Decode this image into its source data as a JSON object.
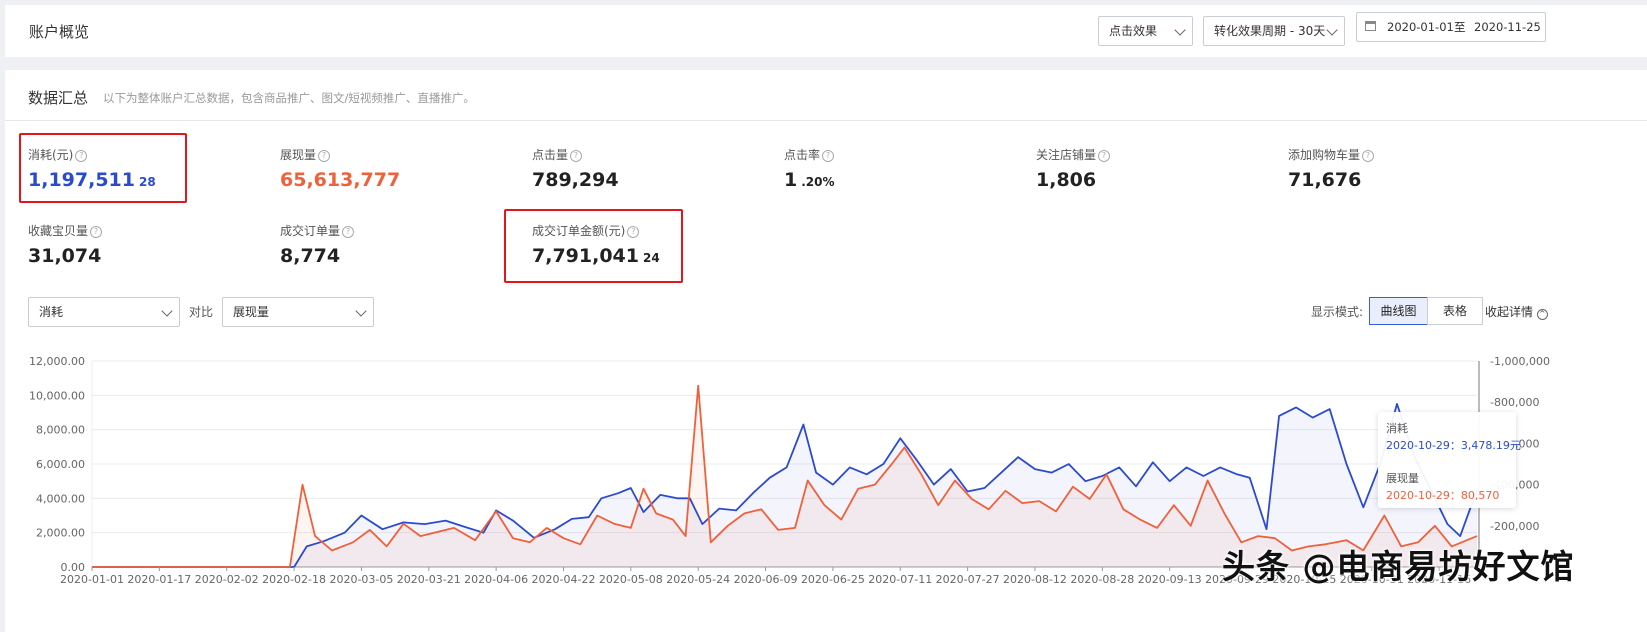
{
  "header": {
    "title": "账户概览",
    "effect_select": "点击效果",
    "period_select": "转化效果周期 - 30天",
    "date_from": "2020-01-01",
    "date_sep": "至",
    "date_to": "2020-11-25"
  },
  "summary": {
    "title": "数据汇总",
    "desc": "以下为整体账户汇总数据，包含商品推广、图文/短视频推广、直播推广。",
    "help_glyph": "?",
    "metrics": [
      {
        "label": "消耗(元)",
        "int": "1,197,511",
        "dec": "28",
        "color": "#2b4bcf"
      },
      {
        "label": "展现量",
        "int": "65,613,777",
        "dec": "",
        "color": "#f0603a"
      },
      {
        "label": "点击量",
        "int": "789,294",
        "dec": "",
        "color": "#222222"
      },
      {
        "label": "点击率",
        "int": "1",
        "dec": ".20%",
        "color": "#222222"
      },
      {
        "label": "关注店铺量",
        "int": "1,806",
        "dec": "",
        "color": "#222222"
      },
      {
        "label": "添加购物车量",
        "int": "71,676",
        "dec": "",
        "color": "#222222"
      },
      {
        "label": "收藏宝贝量",
        "int": "31,074",
        "dec": "",
        "color": "#222222"
      },
      {
        "label": "成交订单量",
        "int": "8,774",
        "dec": "",
        "color": "#222222"
      },
      {
        "label": "成交订单金额(元)",
        "int": "7,791,041",
        "dec": "24",
        "color": "#222222"
      }
    ]
  },
  "chart_controls": {
    "primary_select": "消耗",
    "compare_label": "对比",
    "secondary_select": "展现量",
    "mode_label": "显示模式:",
    "mode_curve": "曲线图",
    "mode_table": "表格",
    "collapse": "收起详情"
  },
  "tooltip": {
    "s1_name": "消耗",
    "s1_line": "2020-10-29：3,478.19元",
    "s2_name": "展现量",
    "s2_line": "2020-10-29：80,570"
  },
  "watermark": "头条 @电商易坊好文馆",
  "colors": {
    "blue": "#2b4bcf",
    "orange": "#f0603a",
    "highlight": "#e3161b"
  },
  "chart_data": {
    "type": "line",
    "x_ticks": [
      "2020-01-01",
      "2020-01-17",
      "2020-02-02",
      "2020-02-18",
      "2020-03-05",
      "2020-03-21",
      "2020-04-06",
      "2020-04-22",
      "2020-05-08",
      "2020-05-24",
      "2020-06-09",
      "2020-06-25",
      "2020-07-11",
      "2020-07-27",
      "2020-08-12",
      "2020-08-28",
      "2020-09-13",
      "2020-09-29",
      "2020-10-15",
      "2020-10-31",
      "2020-11-16"
    ],
    "y_left_ticks": [
      "0.00",
      "2,000.00",
      "4,000.00",
      "6,000.00",
      "8,000.00",
      "10,000.00",
      "12,000.00"
    ],
    "y_right_ticks": [
      "200,000",
      "400,000",
      "600,000",
      "800,000",
      "1,000,000"
    ],
    "ylim_left": [
      0,
      12000
    ],
    "ylim_right": [
      0,
      1000000
    ],
    "series": [
      {
        "name": "消耗",
        "axis": "left",
        "color": "#2b4bcf",
        "points": [
          [
            "2020-01-01",
            0
          ],
          [
            "2020-02-18",
            0
          ],
          [
            "2020-02-21",
            1200
          ],
          [
            "2020-02-25",
            1500
          ],
          [
            "2020-03-01",
            2000
          ],
          [
            "2020-03-05",
            3000
          ],
          [
            "2020-03-10",
            2200
          ],
          [
            "2020-03-15",
            2600
          ],
          [
            "2020-03-20",
            2500
          ],
          [
            "2020-03-25",
            2700
          ],
          [
            "2020-03-30",
            2300
          ],
          [
            "2020-04-03",
            2000
          ],
          [
            "2020-04-06",
            3300
          ],
          [
            "2020-04-10",
            2700
          ],
          [
            "2020-04-15",
            1700
          ],
          [
            "2020-04-20",
            2200
          ],
          [
            "2020-04-24",
            2800
          ],
          [
            "2020-04-28",
            2900
          ],
          [
            "2020-05-01",
            4000
          ],
          [
            "2020-05-05",
            4300
          ],
          [
            "2020-05-08",
            4600
          ],
          [
            "2020-05-11",
            3200
          ],
          [
            "2020-05-15",
            4200
          ],
          [
            "2020-05-19",
            4000
          ],
          [
            "2020-05-22",
            4000
          ],
          [
            "2020-05-25",
            2500
          ],
          [
            "2020-05-29",
            3400
          ],
          [
            "2020-06-02",
            3300
          ],
          [
            "2020-06-06",
            4300
          ],
          [
            "2020-06-10",
            5200
          ],
          [
            "2020-06-14",
            5800
          ],
          [
            "2020-06-18",
            8300
          ],
          [
            "2020-06-21",
            5500
          ],
          [
            "2020-06-25",
            4800
          ],
          [
            "2020-06-29",
            5800
          ],
          [
            "2020-07-03",
            5400
          ],
          [
            "2020-07-07",
            6000
          ],
          [
            "2020-07-11",
            7500
          ],
          [
            "2020-07-15",
            6200
          ],
          [
            "2020-07-19",
            4800
          ],
          [
            "2020-07-23",
            5700
          ],
          [
            "2020-07-27",
            4400
          ],
          [
            "2020-07-31",
            4600
          ],
          [
            "2020-08-04",
            5500
          ],
          [
            "2020-08-08",
            6400
          ],
          [
            "2020-08-12",
            5700
          ],
          [
            "2020-08-16",
            5500
          ],
          [
            "2020-08-20",
            6000
          ],
          [
            "2020-08-24",
            5000
          ],
          [
            "2020-08-28",
            5300
          ],
          [
            "2020-09-01",
            5800
          ],
          [
            "2020-09-05",
            4700
          ],
          [
            "2020-09-09",
            6100
          ],
          [
            "2020-09-13",
            5000
          ],
          [
            "2020-09-17",
            5800
          ],
          [
            "2020-09-21",
            5300
          ],
          [
            "2020-09-25",
            5800
          ],
          [
            "2020-09-29",
            5400
          ],
          [
            "2020-10-02",
            5200
          ],
          [
            "2020-10-06",
            2200
          ],
          [
            "2020-10-09",
            8800
          ],
          [
            "2020-10-13",
            9300
          ],
          [
            "2020-10-17",
            8700
          ],
          [
            "2020-10-21",
            9200
          ],
          [
            "2020-10-25",
            6000
          ],
          [
            "2020-10-29",
            3478
          ],
          [
            "2020-11-02",
            6000
          ],
          [
            "2020-11-06",
            9500
          ],
          [
            "2020-11-10",
            6500
          ],
          [
            "2020-11-14",
            4500
          ],
          [
            "2020-11-18",
            2500
          ],
          [
            "2020-11-21",
            1800
          ],
          [
            "2020-11-25",
            4500
          ]
        ]
      },
      {
        "name": "展现量",
        "axis": "right",
        "color": "#f0603a",
        "points": [
          [
            "2020-01-01",
            0
          ],
          [
            "2020-02-17",
            0
          ],
          [
            "2020-02-20",
            400000
          ],
          [
            "2020-02-23",
            150000
          ],
          [
            "2020-02-27",
            80000
          ],
          [
            "2020-03-03",
            120000
          ],
          [
            "2020-03-07",
            180000
          ],
          [
            "2020-03-11",
            100000
          ],
          [
            "2020-03-15",
            210000
          ],
          [
            "2020-03-19",
            150000
          ],
          [
            "2020-03-23",
            170000
          ],
          [
            "2020-03-27",
            190000
          ],
          [
            "2020-04-01",
            130000
          ],
          [
            "2020-04-06",
            270000
          ],
          [
            "2020-04-10",
            140000
          ],
          [
            "2020-04-14",
            120000
          ],
          [
            "2020-04-18",
            190000
          ],
          [
            "2020-04-22",
            140000
          ],
          [
            "2020-04-26",
            110000
          ],
          [
            "2020-04-30",
            250000
          ],
          [
            "2020-05-04",
            210000
          ],
          [
            "2020-05-08",
            190000
          ],
          [
            "2020-05-11",
            380000
          ],
          [
            "2020-05-14",
            260000
          ],
          [
            "2020-05-18",
            230000
          ],
          [
            "2020-05-21",
            150000
          ],
          [
            "2020-05-24",
            880000
          ],
          [
            "2020-05-27",
            120000
          ],
          [
            "2020-05-31",
            200000
          ],
          [
            "2020-06-04",
            260000
          ],
          [
            "2020-06-08",
            280000
          ],
          [
            "2020-06-12",
            180000
          ],
          [
            "2020-06-16",
            190000
          ],
          [
            "2020-06-19",
            420000
          ],
          [
            "2020-06-23",
            300000
          ],
          [
            "2020-06-27",
            230000
          ],
          [
            "2020-07-01",
            380000
          ],
          [
            "2020-07-05",
            400000
          ],
          [
            "2020-07-09",
            500000
          ],
          [
            "2020-07-12",
            580000
          ],
          [
            "2020-07-16",
            450000
          ],
          [
            "2020-07-20",
            300000
          ],
          [
            "2020-07-24",
            420000
          ],
          [
            "2020-07-28",
            330000
          ],
          [
            "2020-08-01",
            280000
          ],
          [
            "2020-08-05",
            370000
          ],
          [
            "2020-08-09",
            310000
          ],
          [
            "2020-08-13",
            320000
          ],
          [
            "2020-08-17",
            270000
          ],
          [
            "2020-08-21",
            390000
          ],
          [
            "2020-08-25",
            330000
          ],
          [
            "2020-08-29",
            450000
          ],
          [
            "2020-09-02",
            280000
          ],
          [
            "2020-09-06",
            230000
          ],
          [
            "2020-09-10",
            190000
          ],
          [
            "2020-09-14",
            300000
          ],
          [
            "2020-09-18",
            200000
          ],
          [
            "2020-09-22",
            420000
          ],
          [
            "2020-09-26",
            260000
          ],
          [
            "2020-09-30",
            120000
          ],
          [
            "2020-10-04",
            150000
          ],
          [
            "2020-10-08",
            140000
          ],
          [
            "2020-10-12",
            80000
          ],
          [
            "2020-10-16",
            100000
          ],
          [
            "2020-10-20",
            110000
          ],
          [
            "2020-10-25",
            130000
          ],
          [
            "2020-10-29",
            80570
          ],
          [
            "2020-11-03",
            250000
          ],
          [
            "2020-11-07",
            100000
          ],
          [
            "2020-11-11",
            120000
          ],
          [
            "2020-11-15",
            200000
          ],
          [
            "2020-11-19",
            100000
          ],
          [
            "2020-11-25",
            150000
          ]
        ]
      }
    ],
    "tooltip_date": "2020-10-29",
    "grid": true
  }
}
